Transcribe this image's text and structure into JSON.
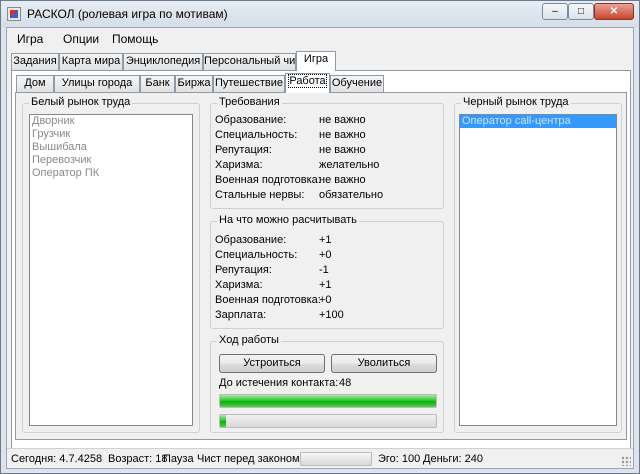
{
  "window": {
    "title": "РАСКОЛ (ролевая игра по мотивам)",
    "controls": {
      "minimize": "–",
      "maximize": "□",
      "close": "✕"
    }
  },
  "menu": [
    "Игра",
    "Опции",
    "Помощь"
  ],
  "main_tabs": [
    "Задания",
    "Карта мира",
    "Энциклопедия",
    "Персональный чип",
    "Игра"
  ],
  "main_tab_active": "Игра",
  "sub_tabs": [
    "Дом",
    "Улицы города",
    "Банк",
    "Биржа",
    "Путешествие",
    "Работа",
    "Обучение"
  ],
  "sub_tab_active": "Работа",
  "white_market": {
    "label": "Белый рынок труда",
    "items": [
      "Дворник",
      "Грузчик",
      "Вышибала",
      "Перевозчик",
      "Оператор ПК"
    ]
  },
  "requirements": {
    "label": "Требования",
    "rows": [
      {
        "key": "Образование:",
        "value": "не важно"
      },
      {
        "key": "Специальность:",
        "value": "не важно"
      },
      {
        "key": "Репутация:",
        "value": "не важно"
      },
      {
        "key": "Харизма:",
        "value": "желательно"
      },
      {
        "key": "Военная подготовка:",
        "value": "не важно"
      },
      {
        "key": "Стальные нервы:",
        "value": "обязательно"
      }
    ]
  },
  "rewards": {
    "label": "На что можно расчитывать",
    "rows": [
      {
        "key": "Образование:",
        "value": "+1"
      },
      {
        "key": "Специальность:",
        "value": "+0"
      },
      {
        "key": "Репутация:",
        "value": "-1"
      },
      {
        "key": "Харизма:",
        "value": "+1"
      },
      {
        "key": "Военная подготовка:",
        "value": "+0"
      },
      {
        "key": "Зарплата:",
        "value": "+100"
      }
    ]
  },
  "work": {
    "label": "Ход работы",
    "hire_button": "Устроиться",
    "quit_button": "Уволиться",
    "contract_label": "До истечения контакта:",
    "contract_value": "48",
    "progress1": 1.0,
    "progress2": 0.03
  },
  "black_market": {
    "label": "Черный рынок труда",
    "items": [
      "Оператор call-центра"
    ],
    "selected": "Оператор call-центра"
  },
  "status": {
    "today": "Сегодня: 4.7.4258",
    "age": "Возраст: 18",
    "pause": "Пауза",
    "law": "Чист перед законом",
    "ego": "Эго: 100",
    "money": "Деньги: 240"
  }
}
